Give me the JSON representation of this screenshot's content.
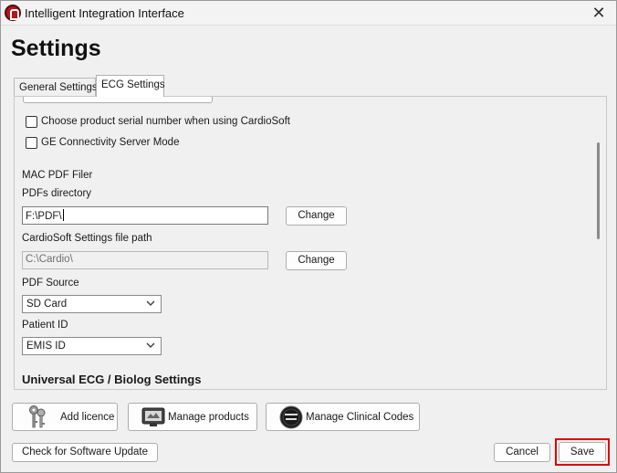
{
  "window": {
    "title": "Intelligent Integration Interface",
    "close_glyph": "✕"
  },
  "page": {
    "heading": "Settings"
  },
  "tabs": [
    {
      "label": "General Settings",
      "active": false
    },
    {
      "label": "ECG Settings",
      "active": true
    }
  ],
  "ecg": {
    "checkboxes": [
      {
        "label": "Choose product serial number when using CardioSoft",
        "checked": false
      },
      {
        "label": "GE Connectivity Server Mode",
        "checked": false
      }
    ],
    "mac_pdf_filer_label": "MAC PDF Filer",
    "pdfs_directory": {
      "label": "PDFs directory",
      "value": "F:\\PDF\\",
      "change_label": "Change"
    },
    "cardiosoft_path": {
      "label": "CardioSoft Settings file path",
      "value": "C:\\Cardio\\",
      "change_label": "Change"
    },
    "pdf_source": {
      "label": "PDF Source",
      "selected": "SD Card"
    },
    "patient_id": {
      "label": "Patient ID",
      "selected": "EMIS ID"
    },
    "universal_heading": "Universal ECG / Biolog Settings"
  },
  "actions": {
    "add_licence": "Add licence",
    "manage_products": "Manage products",
    "manage_clinical_codes": "Manage Clinical Codes",
    "check_update": "Check for Software Update",
    "cancel": "Cancel",
    "save": "Save"
  },
  "colors": {
    "highlight": "#e00000",
    "brand": "#b3161b"
  },
  "icons": {
    "app": "app-logo-icon",
    "add_licence": "keys-icon",
    "manage_products": "monitor-icon",
    "manage_clinical_codes": "binary-disc-icon"
  }
}
